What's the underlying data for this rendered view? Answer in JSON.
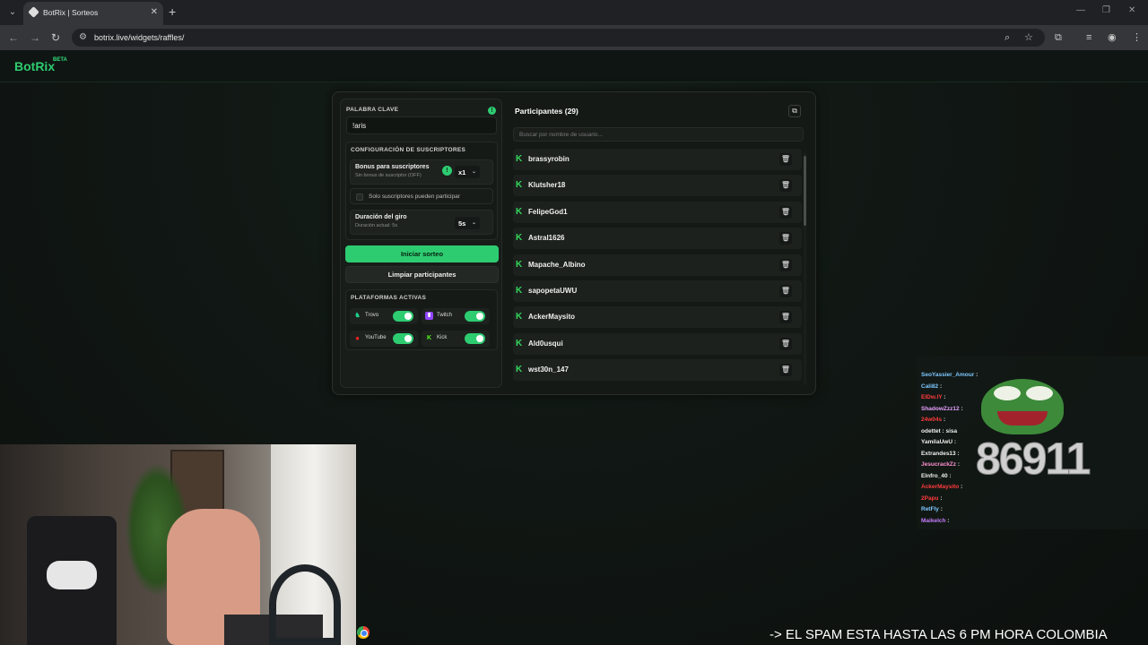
{
  "browser": {
    "tab_title": "BotRix | Sorteos",
    "url": "botrix.live/widgets/raffles/"
  },
  "app": {
    "logo": "BotRix",
    "badge": "BETA"
  },
  "raffle": {
    "keyword_label": "PALABRA CLAVE",
    "keyword_value": "!aris",
    "subs_config_label": "CONFIGURACIÓN DE SUSCRIPTORES",
    "bonus_title": "Bonus para suscriptores",
    "bonus_sub": "Sin bonus de suscriptor (OFF)",
    "bonus_select": "x1",
    "only_subs_label": "Solo suscriptores pueden participar",
    "spin_title": "Duración del giro",
    "spin_sub": "Duración actual: 5s",
    "spin_select": "5s",
    "start_button": "Iniciar sorteo",
    "clear_button": "Limpiar participantes",
    "platforms_label": "PLATAFORMAS ACTIVAS",
    "platforms": [
      {
        "label": "Trovo",
        "color": "#1ecf87",
        "enabled": true
      },
      {
        "label": "Twitch",
        "color": "#9146ff",
        "enabled": true
      },
      {
        "label": "YouTube",
        "color": "#ff0000",
        "enabled": true
      },
      {
        "label": "Kick",
        "color": "#53fc18",
        "enabled": true
      }
    ]
  },
  "participants": {
    "title": "Participantes (29)",
    "search_placeholder": "Buscar por nombre de usuario...",
    "items": [
      "brassyrobin",
      "Klutsher18",
      "FelipeGod1",
      "Astral1626",
      "Mapache_Albino",
      "sapopetaUWU",
      "AckerMaysito",
      "Ald0usqui",
      "wst30n_147"
    ]
  },
  "chat": {
    "lines": [
      {
        "user": "SeoYassier_Amour",
        "msg": ":",
        "color": "#7ec8ff"
      },
      {
        "user": "Cali82",
        "msg": ":",
        "color": "#7ec8ff"
      },
      {
        "user": "ElDw.lY",
        "msg": ":",
        "color": "#ff3b3b"
      },
      {
        "user": "ShadowZzz12",
        "msg": ":",
        "color": "#e8a0ff"
      },
      {
        "user": "24w04s",
        "msg": ":",
        "color": "#ff3b3b"
      },
      {
        "user": "odettet",
        "msg": ": sisa",
        "color": "#eeeeee"
      },
      {
        "user": "YamilaUwU",
        "msg": ":",
        "color": "#eeeeee"
      },
      {
        "user": "Extrandes13",
        "msg": ":",
        "color": "#eeeeee"
      },
      {
        "user": "JesucrackZz",
        "msg": ":",
        "color": "#ff8fd0"
      },
      {
        "user": "Elnfro_40",
        "msg": ":",
        "color": "#eeeeee"
      },
      {
        "user": "AckerMaysito",
        "msg": ":",
        "color": "#ff3b3b"
      },
      {
        "user": "2Papu",
        "msg": ":",
        "color": "#ff3b3b"
      },
      {
        "user": "RetFly",
        "msg": ":",
        "color": "#7ec8ff"
      },
      {
        "user": "Maikelch",
        "msg": ":",
        "color": "#c77dff"
      }
    ],
    "overlay_number": "86911"
  },
  "ticker": "-> EL SPAM ESTA HASTA LAS 6 PM HORA COLOMBIA"
}
